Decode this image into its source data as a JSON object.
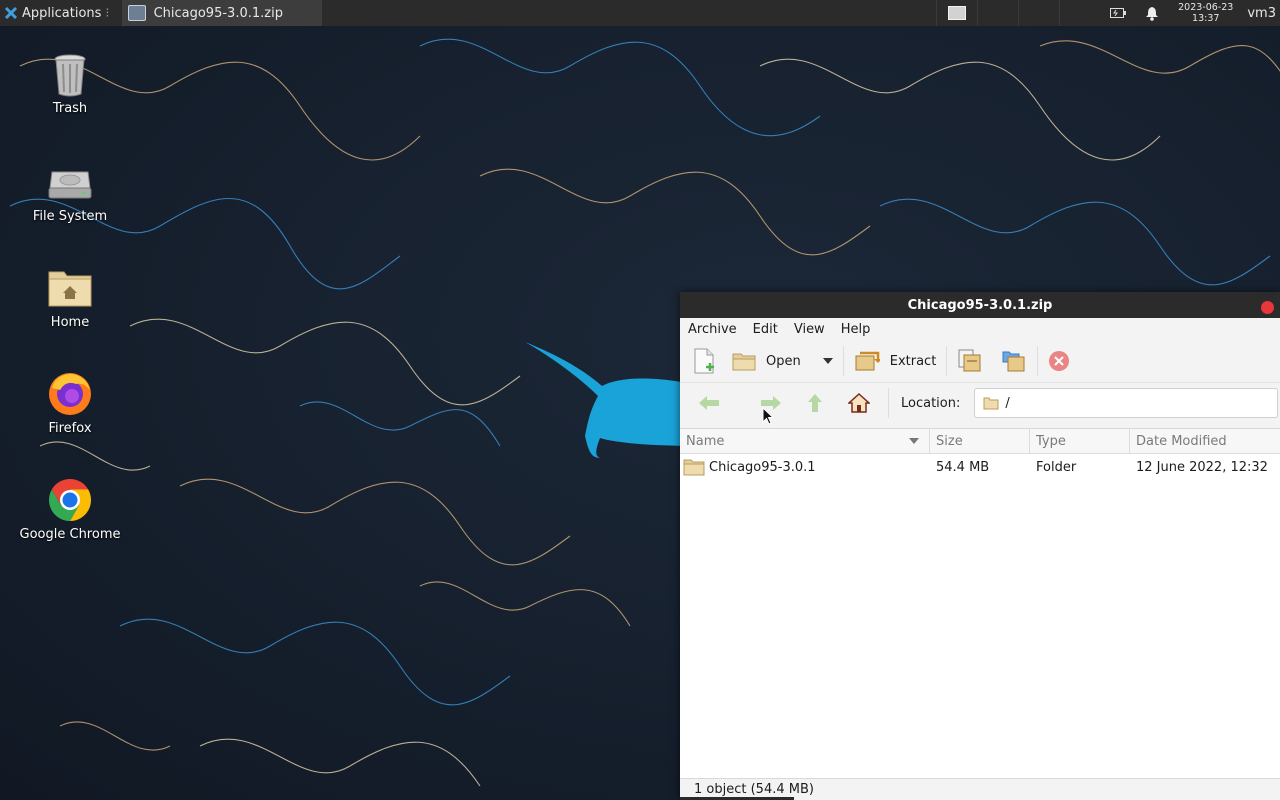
{
  "panel": {
    "applications_label": "Applications",
    "task_title": "Chicago95-3.0.1.zip",
    "clock_date": "2023-06-23",
    "clock_time": "13:37",
    "user": "vm3"
  },
  "desktop": {
    "icons": [
      {
        "label": "Trash"
      },
      {
        "label": "File System"
      },
      {
        "label": "Home"
      },
      {
        "label": "Firefox"
      },
      {
        "label": "Google Chrome"
      }
    ]
  },
  "window": {
    "title": "Chicago95-3.0.1.zip",
    "menu": [
      "Archive",
      "Edit",
      "View",
      "Help"
    ],
    "toolbar": {
      "open_label": "Open",
      "extract_label": "Extract"
    },
    "location_label": "Location:",
    "location_value": "/",
    "columns": [
      "Name",
      "Size",
      "Type",
      "Date Modified"
    ],
    "rows": [
      {
        "name": "Chicago95-3.0.1",
        "size": "54.4 MB",
        "type": "Folder",
        "date": "12 June 2022, 12:32"
      }
    ],
    "status": "1 object (54.4 MB)"
  },
  "colors": {
    "panel_bg": "#2b2b2b",
    "close_button": "#e8373a",
    "wallpaper_bg": "#16202e",
    "wallpaper_mascot": "#1aa3d9"
  }
}
